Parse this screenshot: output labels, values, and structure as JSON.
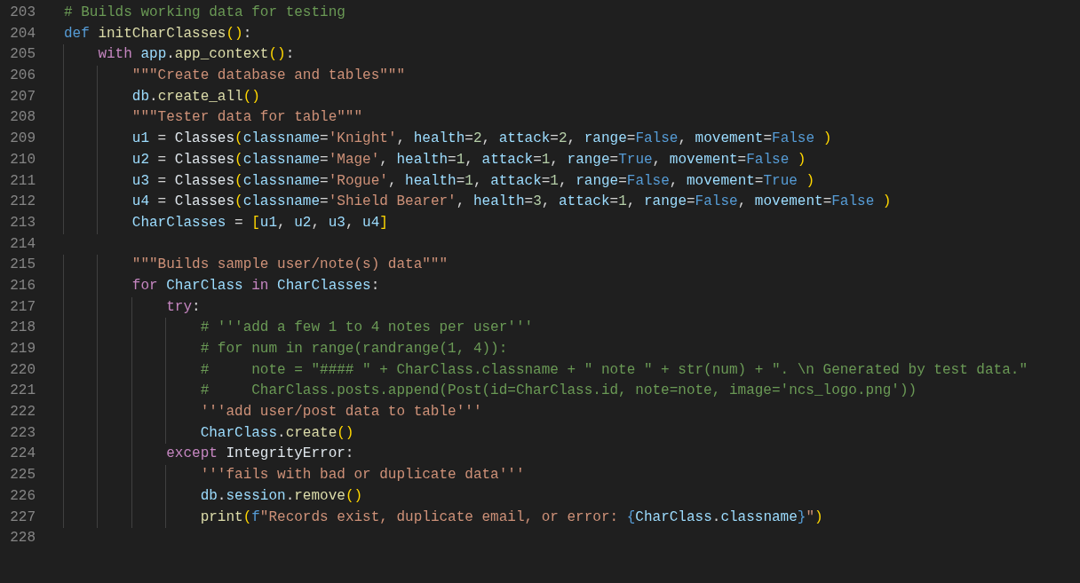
{
  "editor": {
    "lines": [
      {
        "number": "203",
        "tokens": [
          {
            "kind": "c",
            "text": "# Builds working data for testing"
          }
        ]
      },
      {
        "number": "204",
        "tokens": [
          {
            "kind": "k",
            "text": "def "
          },
          {
            "kind": "f",
            "text": "initCharClasses"
          },
          {
            "kind": "b1",
            "text": "()"
          },
          {
            "kind": "p",
            "text": ":"
          }
        ]
      },
      {
        "number": "205",
        "tokens": [
          {
            "kind": "x",
            "text": "    with "
          },
          {
            "kind": "v",
            "text": "app"
          },
          {
            "kind": "p",
            "text": "."
          },
          {
            "kind": "f",
            "text": "app_context"
          },
          {
            "kind": "b1",
            "text": "()"
          },
          {
            "kind": "p",
            "text": ":"
          }
        ]
      },
      {
        "number": "206",
        "tokens": [
          {
            "kind": "s",
            "text": "        \"\"\"Create database and tables\"\"\""
          }
        ]
      },
      {
        "number": "207",
        "tokens": [
          {
            "kind": "v",
            "text": "        db"
          },
          {
            "kind": "p",
            "text": "."
          },
          {
            "kind": "f",
            "text": "create_all"
          },
          {
            "kind": "b1",
            "text": "()"
          }
        ]
      },
      {
        "number": "208",
        "tokens": [
          {
            "kind": "s",
            "text": "        \"\"\"Tester data for table\"\"\""
          }
        ]
      },
      {
        "number": "209",
        "tokens": [
          {
            "kind": "v",
            "text": "        u1"
          },
          {
            "kind": "p",
            "text": " = "
          },
          {
            "kind": "t",
            "text": "Classes"
          },
          {
            "kind": "b1",
            "text": "("
          },
          {
            "kind": "v",
            "text": "classname"
          },
          {
            "kind": "p",
            "text": "="
          },
          {
            "kind": "s",
            "text": "'Knight'"
          },
          {
            "kind": "p",
            "text": ", "
          },
          {
            "kind": "v",
            "text": "health"
          },
          {
            "kind": "p",
            "text": "="
          },
          {
            "kind": "n",
            "text": "2"
          },
          {
            "kind": "p",
            "text": ", "
          },
          {
            "kind": "v",
            "text": "attack"
          },
          {
            "kind": "p",
            "text": "="
          },
          {
            "kind": "n",
            "text": "2"
          },
          {
            "kind": "p",
            "text": ", "
          },
          {
            "kind": "v",
            "text": "range"
          },
          {
            "kind": "p",
            "text": "="
          },
          {
            "kind": "k",
            "text": "False"
          },
          {
            "kind": "p",
            "text": ", "
          },
          {
            "kind": "v",
            "text": "movement"
          },
          {
            "kind": "p",
            "text": "="
          },
          {
            "kind": "k",
            "text": "False"
          },
          {
            "kind": "b1",
            "text": " )"
          }
        ]
      },
      {
        "number": "210",
        "tokens": [
          {
            "kind": "v",
            "text": "        u2"
          },
          {
            "kind": "p",
            "text": " = "
          },
          {
            "kind": "t",
            "text": "Classes"
          },
          {
            "kind": "b1",
            "text": "("
          },
          {
            "kind": "v",
            "text": "classname"
          },
          {
            "kind": "p",
            "text": "="
          },
          {
            "kind": "s",
            "text": "'Mage'"
          },
          {
            "kind": "p",
            "text": ", "
          },
          {
            "kind": "v",
            "text": "health"
          },
          {
            "kind": "p",
            "text": "="
          },
          {
            "kind": "n",
            "text": "1"
          },
          {
            "kind": "p",
            "text": ", "
          },
          {
            "kind": "v",
            "text": "attack"
          },
          {
            "kind": "p",
            "text": "="
          },
          {
            "kind": "n",
            "text": "1"
          },
          {
            "kind": "p",
            "text": ", "
          },
          {
            "kind": "v",
            "text": "range"
          },
          {
            "kind": "p",
            "text": "="
          },
          {
            "kind": "k",
            "text": "True"
          },
          {
            "kind": "p",
            "text": ", "
          },
          {
            "kind": "v",
            "text": "movement"
          },
          {
            "kind": "p",
            "text": "="
          },
          {
            "kind": "k",
            "text": "False"
          },
          {
            "kind": "b1",
            "text": " )"
          }
        ]
      },
      {
        "number": "211",
        "tokens": [
          {
            "kind": "v",
            "text": "        u3"
          },
          {
            "kind": "p",
            "text": " = "
          },
          {
            "kind": "t",
            "text": "Classes"
          },
          {
            "kind": "b1",
            "text": "("
          },
          {
            "kind": "v",
            "text": "classname"
          },
          {
            "kind": "p",
            "text": "="
          },
          {
            "kind": "s",
            "text": "'Rogue'"
          },
          {
            "kind": "p",
            "text": ", "
          },
          {
            "kind": "v",
            "text": "health"
          },
          {
            "kind": "p",
            "text": "="
          },
          {
            "kind": "n",
            "text": "1"
          },
          {
            "kind": "p",
            "text": ", "
          },
          {
            "kind": "v",
            "text": "attack"
          },
          {
            "kind": "p",
            "text": "="
          },
          {
            "kind": "n",
            "text": "1"
          },
          {
            "kind": "p",
            "text": ", "
          },
          {
            "kind": "v",
            "text": "range"
          },
          {
            "kind": "p",
            "text": "="
          },
          {
            "kind": "k",
            "text": "False"
          },
          {
            "kind": "p",
            "text": ", "
          },
          {
            "kind": "v",
            "text": "movement"
          },
          {
            "kind": "p",
            "text": "="
          },
          {
            "kind": "k",
            "text": "True"
          },
          {
            "kind": "b1",
            "text": " )"
          }
        ]
      },
      {
        "number": "212",
        "tokens": [
          {
            "kind": "v",
            "text": "        u4"
          },
          {
            "kind": "p",
            "text": " = "
          },
          {
            "kind": "t",
            "text": "Classes"
          },
          {
            "kind": "b1",
            "text": "("
          },
          {
            "kind": "v",
            "text": "classname"
          },
          {
            "kind": "p",
            "text": "="
          },
          {
            "kind": "s",
            "text": "'Shield Bearer'"
          },
          {
            "kind": "p",
            "text": ", "
          },
          {
            "kind": "v",
            "text": "health"
          },
          {
            "kind": "p",
            "text": "="
          },
          {
            "kind": "n",
            "text": "3"
          },
          {
            "kind": "p",
            "text": ", "
          },
          {
            "kind": "v",
            "text": "attack"
          },
          {
            "kind": "p",
            "text": "="
          },
          {
            "kind": "n",
            "text": "1"
          },
          {
            "kind": "p",
            "text": ", "
          },
          {
            "kind": "v",
            "text": "range"
          },
          {
            "kind": "p",
            "text": "="
          },
          {
            "kind": "k",
            "text": "False"
          },
          {
            "kind": "p",
            "text": ", "
          },
          {
            "kind": "v",
            "text": "movement"
          },
          {
            "kind": "p",
            "text": "="
          },
          {
            "kind": "k",
            "text": "False"
          },
          {
            "kind": "b1",
            "text": " )"
          }
        ]
      },
      {
        "number": "213",
        "tokens": [
          {
            "kind": "v",
            "text": "        CharClasses"
          },
          {
            "kind": "p",
            "text": " = "
          },
          {
            "kind": "b1",
            "text": "["
          },
          {
            "kind": "v",
            "text": "u1"
          },
          {
            "kind": "p",
            "text": ", "
          },
          {
            "kind": "v",
            "text": "u2"
          },
          {
            "kind": "p",
            "text": ", "
          },
          {
            "kind": "v",
            "text": "u3"
          },
          {
            "kind": "p",
            "text": ", "
          },
          {
            "kind": "v",
            "text": "u4"
          },
          {
            "kind": "b1",
            "text": "]"
          }
        ]
      },
      {
        "number": "214"
      },
      {
        "number": "215",
        "tokens": [
          {
            "kind": "s",
            "text": "        \"\"\"Builds sample user/note(s) data\"\"\""
          }
        ]
      },
      {
        "number": "216",
        "tokens": [
          {
            "kind": "x",
            "text": "        for "
          },
          {
            "kind": "v",
            "text": "CharClass "
          },
          {
            "kind": "x",
            "text": "in "
          },
          {
            "kind": "v",
            "text": "CharClasses"
          },
          {
            "kind": "p",
            "text": ":"
          }
        ]
      },
      {
        "number": "217",
        "tokens": [
          {
            "kind": "x",
            "text": "            try"
          },
          {
            "kind": "p",
            "text": ":"
          }
        ]
      },
      {
        "number": "218",
        "tokens": [
          {
            "kind": "c",
            "text": "                # '''add a few 1 to 4 notes per user'''"
          }
        ]
      },
      {
        "number": "219",
        "tokens": [
          {
            "kind": "c",
            "text": "                # for num in range(randrange(1, 4)):"
          }
        ]
      },
      {
        "number": "220",
        "tokens": [
          {
            "kind": "c",
            "text": "                #     note = \"#### \" + CharClass.classname + \" note \" + str(num) + \". \\n Generated by test data.\""
          }
        ]
      },
      {
        "number": "221",
        "tokens": [
          {
            "kind": "c",
            "text": "                #     CharClass.posts.append(Post(id=CharClass.id, note=note, image='ncs_logo.png'))"
          }
        ]
      },
      {
        "number": "222",
        "tokens": [
          {
            "kind": "s",
            "text": "                '''add user/post data to table'''"
          }
        ]
      },
      {
        "number": "223",
        "tokens": [
          {
            "kind": "v",
            "text": "                CharClass"
          },
          {
            "kind": "p",
            "text": "."
          },
          {
            "kind": "f",
            "text": "create"
          },
          {
            "kind": "b1",
            "text": "()"
          }
        ]
      },
      {
        "number": "224",
        "tokens": [
          {
            "kind": "x",
            "text": "            except "
          },
          {
            "kind": "t",
            "text": "IntegrityError"
          },
          {
            "kind": "p",
            "text": ":"
          }
        ]
      },
      {
        "number": "225",
        "tokens": [
          {
            "kind": "s",
            "text": "                '''fails with bad or duplicate data'''"
          }
        ]
      },
      {
        "number": "226",
        "tokens": [
          {
            "kind": "v",
            "text": "                db"
          },
          {
            "kind": "p",
            "text": "."
          },
          {
            "kind": "v",
            "text": "session"
          },
          {
            "kind": "p",
            "text": "."
          },
          {
            "kind": "f",
            "text": "remove"
          },
          {
            "kind": "b1",
            "text": "()"
          }
        ]
      },
      {
        "number": "227",
        "tokens": [
          {
            "kind": "f",
            "text": "                print"
          },
          {
            "kind": "b1",
            "text": "("
          },
          {
            "kind": "k",
            "text": "f"
          },
          {
            "kind": "s",
            "text": "\"Records exist, duplicate email, or error: "
          },
          {
            "kind": "k",
            "text": "{"
          },
          {
            "kind": "v",
            "text": "CharClass"
          },
          {
            "kind": "p",
            "text": "."
          },
          {
            "kind": "v",
            "text": "classname"
          },
          {
            "kind": "k",
            "text": "}"
          },
          {
            "kind": "s",
            "text": "\""
          },
          {
            "kind": "b1",
            "text": ")"
          }
        ]
      },
      {
        "number": "228"
      }
    ]
  }
}
